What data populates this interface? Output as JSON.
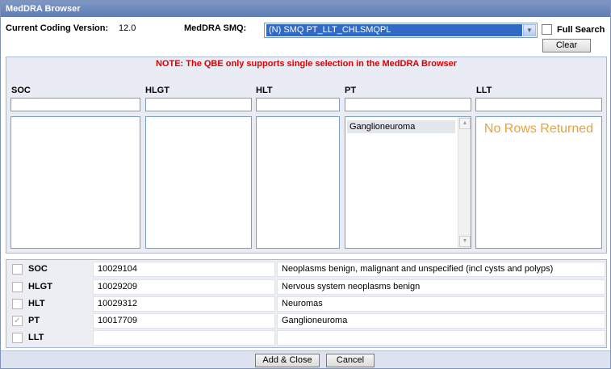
{
  "window": {
    "title": "MedDRA Browser"
  },
  "header": {
    "coding_version_label": "Current Coding Version:",
    "coding_version_value": "12.0",
    "smq_label": "MedDRA SMQ:",
    "smq_selected": "(N) SMQ PT_LLT_CHLSMQPL",
    "full_search_label": "Full Search",
    "clear_label": "Clear"
  },
  "qbe": {
    "note": "NOTE: The QBE only supports single selection in the MedDRA Browser",
    "columns": [
      {
        "label": "SOC"
      },
      {
        "label": "HLGT"
      },
      {
        "label": "HLT"
      },
      {
        "label": "PT",
        "items": [
          "Ganglioneuroma"
        ]
      },
      {
        "label": "LLT",
        "empty_message": "No Rows Returned"
      }
    ]
  },
  "results": [
    {
      "level": "SOC",
      "code": "10029104",
      "name": "Neoplasms benign, malignant and unspecified (incl cysts and polyps)",
      "checked": false
    },
    {
      "level": "HLGT",
      "code": "10029209",
      "name": "Nervous system neoplasms benign",
      "checked": false
    },
    {
      "level": "HLT",
      "code": "10029312",
      "name": "Neuromas",
      "checked": false
    },
    {
      "level": "PT",
      "code": "10017709",
      "name": "Ganglioneuroma",
      "checked": true
    },
    {
      "level": "LLT",
      "code": "",
      "name": "",
      "checked": false
    }
  ],
  "footer": {
    "add_close_label": "Add & Close",
    "cancel_label": "Cancel"
  },
  "colors": {
    "titlebar": "#6a87bd",
    "note": "#e00000",
    "no_rows": "#e8a13c",
    "selection": "#316ac5"
  }
}
